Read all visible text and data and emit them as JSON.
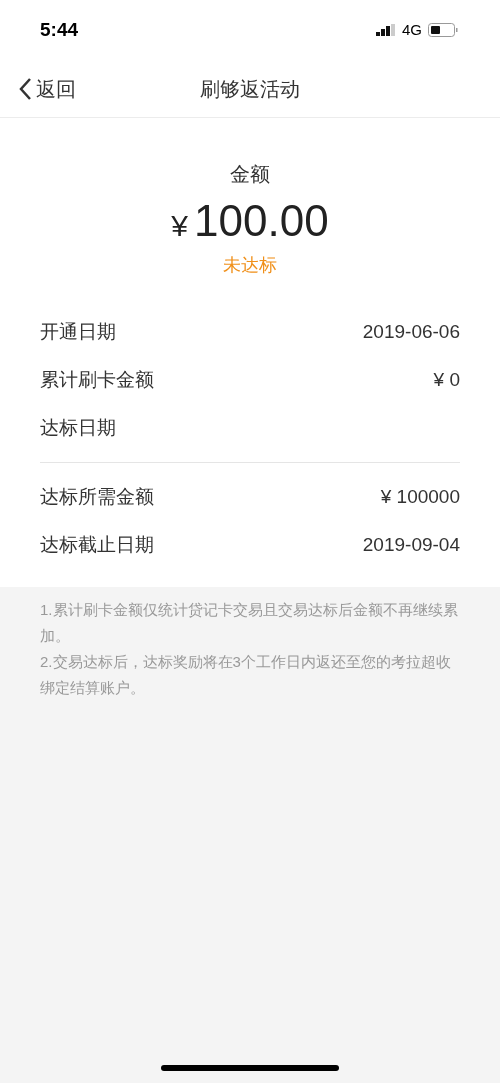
{
  "status_bar": {
    "time": "5:44",
    "network": "4G"
  },
  "nav": {
    "back": "返回",
    "title": "刷够返活动"
  },
  "amount": {
    "label": "金额",
    "currency": "¥",
    "value": "100.00",
    "status": "未达标"
  },
  "groups": [
    {
      "rows": [
        {
          "label": "开通日期",
          "value": "2019-06-06"
        },
        {
          "label": "累计刷卡金额",
          "value": "¥ 0"
        },
        {
          "label": "达标日期"
        }
      ]
    },
    {
      "rows": [
        {
          "label": "达标所需金额",
          "value": "¥ 100000"
        },
        {
          "label": "达标截止日期",
          "value": "2019-09-04"
        }
      ]
    }
  ],
  "notes": [
    "1.累计刷卡金额仅统计贷记卡交易且交易达标后金额不再继续累加。",
    "2.交易达标后，达标奖励将在3个工作日内返还至您的考拉超收绑定结算账户。"
  ]
}
